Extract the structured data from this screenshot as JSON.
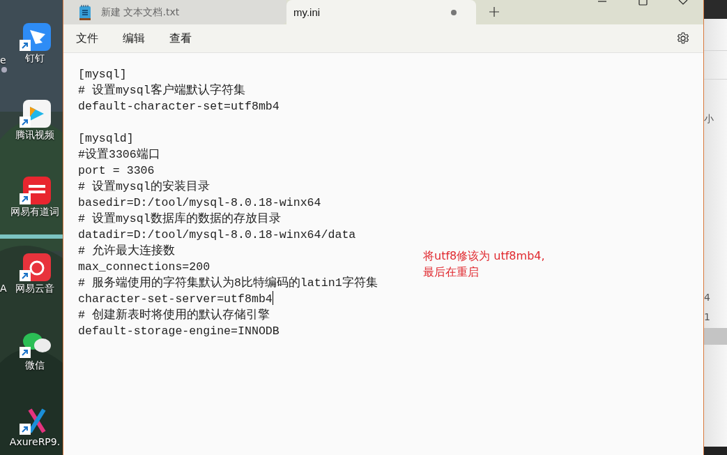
{
  "desktop": {
    "offscreen_labels": [
      "e",
      "A"
    ],
    "icons": [
      {
        "label": "钉钉"
      },
      {
        "label": "腾讯视频"
      },
      {
        "label": "网易有道词"
      },
      {
        "label": "网易云音"
      },
      {
        "label": "微信"
      },
      {
        "label": "AxureRP9."
      }
    ]
  },
  "window": {
    "tabs": [
      {
        "label": "新建 文本文档.txt",
        "selected": false,
        "modified": false
      },
      {
        "label": "my.ini",
        "selected": true,
        "modified": true
      }
    ],
    "menu": [
      "文件",
      "编辑",
      "查看"
    ],
    "editor": {
      "sections": [
        {
          "lines": [
            {
              "text": "[mysql]",
              "caret": false
            },
            {
              "text": "# 设置mysql客户端默认字符集",
              "caret": false
            },
            {
              "text": "default-character-set=utf8mb4",
              "caret": false
            }
          ]
        },
        {
          "lines": [
            {
              "text": "[mysqld]",
              "caret": false
            },
            {
              "text": "#设置3306端口",
              "caret": false
            },
            {
              "text": "port = 3306",
              "caret": false
            },
            {
              "text": "# 设置mysql的安装目录",
              "caret": false
            },
            {
              "text": "basedir=D:/tool/mysql-8.0.18-winx64",
              "caret": false
            },
            {
              "text": "# 设置mysql数据库的数据的存放目录",
              "caret": false
            },
            {
              "text": "datadir=D:/tool/mysql-8.0.18-winx64/data",
              "caret": false
            },
            {
              "text": "# 允许最大连接数",
              "caret": false
            },
            {
              "text": "max_connections=200",
              "caret": false
            },
            {
              "text": "# 服务端使用的字符集默认为8比特编码的latin1字符集",
              "caret": false
            },
            {
              "text": "character-set-server=utf8mb4",
              "caret": true
            },
            {
              "text": "# 创建新表时将使用的默认存储引擎",
              "caret": false
            },
            {
              "text": "default-storage-engine=INNODB",
              "caret": false
            }
          ]
        }
      ],
      "annotation": [
        "将utf8修该为 utf8mb4,",
        "最后在重启"
      ]
    }
  },
  "background_window": {
    "texts": [
      "小",
      "4",
      "1"
    ]
  }
}
